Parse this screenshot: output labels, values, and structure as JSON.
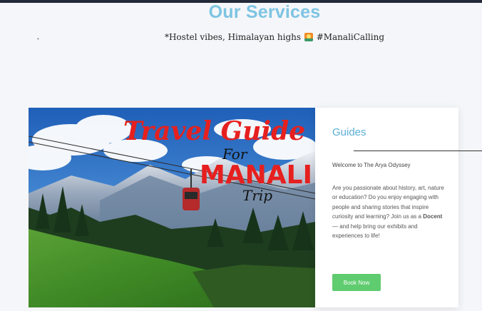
{
  "section": {
    "title": "Our Services",
    "bullet": "•",
    "tagline_before": "*Hostel vibes, Himalayan highs",
    "tagline_icon": "sunrise-over-mountains-icon",
    "tagline_after": "#ManaliCalling"
  },
  "hero": {
    "title_line1": "Travel Guide",
    "title_line2": "For",
    "title_line3": "MANALI",
    "title_line4": "Trip"
  },
  "card": {
    "title": "Guides",
    "welcome": "Welcome to The Arya Odyssey",
    "desc_part1": "Are you passionate about history, art, nature or education? Do you enjoy engaging with people and sharing stories that inspire curiosity and learning? Join us as a",
    "desc_bold": "Docent",
    "desc_part2": "— and help bring our exhibits and experiences to life!",
    "button": "Book Now"
  },
  "colors": {
    "title": "#7ec4e2",
    "card_title": "#5aaed6",
    "button": "#5fcc6f",
    "hero_text_red": "#e6201f"
  }
}
